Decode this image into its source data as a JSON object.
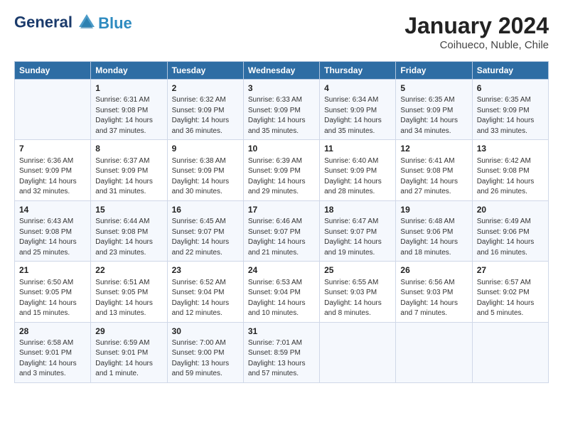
{
  "logo": {
    "line1": "General",
    "line2": "Blue"
  },
  "title": "January 2024",
  "subtitle": "Coihueco, Nuble, Chile",
  "headers": [
    "Sunday",
    "Monday",
    "Tuesday",
    "Wednesday",
    "Thursday",
    "Friday",
    "Saturday"
  ],
  "weeks": [
    [
      {
        "num": "",
        "content": ""
      },
      {
        "num": "1",
        "content": "Sunrise: 6:31 AM\nSunset: 9:08 PM\nDaylight: 14 hours\nand 37 minutes."
      },
      {
        "num": "2",
        "content": "Sunrise: 6:32 AM\nSunset: 9:09 PM\nDaylight: 14 hours\nand 36 minutes."
      },
      {
        "num": "3",
        "content": "Sunrise: 6:33 AM\nSunset: 9:09 PM\nDaylight: 14 hours\nand 35 minutes."
      },
      {
        "num": "4",
        "content": "Sunrise: 6:34 AM\nSunset: 9:09 PM\nDaylight: 14 hours\nand 35 minutes."
      },
      {
        "num": "5",
        "content": "Sunrise: 6:35 AM\nSunset: 9:09 PM\nDaylight: 14 hours\nand 34 minutes."
      },
      {
        "num": "6",
        "content": "Sunrise: 6:35 AM\nSunset: 9:09 PM\nDaylight: 14 hours\nand 33 minutes."
      }
    ],
    [
      {
        "num": "7",
        "content": "Sunrise: 6:36 AM\nSunset: 9:09 PM\nDaylight: 14 hours\nand 32 minutes."
      },
      {
        "num": "8",
        "content": "Sunrise: 6:37 AM\nSunset: 9:09 PM\nDaylight: 14 hours\nand 31 minutes."
      },
      {
        "num": "9",
        "content": "Sunrise: 6:38 AM\nSunset: 9:09 PM\nDaylight: 14 hours\nand 30 minutes."
      },
      {
        "num": "10",
        "content": "Sunrise: 6:39 AM\nSunset: 9:09 PM\nDaylight: 14 hours\nand 29 minutes."
      },
      {
        "num": "11",
        "content": "Sunrise: 6:40 AM\nSunset: 9:09 PM\nDaylight: 14 hours\nand 28 minutes."
      },
      {
        "num": "12",
        "content": "Sunrise: 6:41 AM\nSunset: 9:08 PM\nDaylight: 14 hours\nand 27 minutes."
      },
      {
        "num": "13",
        "content": "Sunrise: 6:42 AM\nSunset: 9:08 PM\nDaylight: 14 hours\nand 26 minutes."
      }
    ],
    [
      {
        "num": "14",
        "content": "Sunrise: 6:43 AM\nSunset: 9:08 PM\nDaylight: 14 hours\nand 25 minutes."
      },
      {
        "num": "15",
        "content": "Sunrise: 6:44 AM\nSunset: 9:08 PM\nDaylight: 14 hours\nand 23 minutes."
      },
      {
        "num": "16",
        "content": "Sunrise: 6:45 AM\nSunset: 9:07 PM\nDaylight: 14 hours\nand 22 minutes."
      },
      {
        "num": "17",
        "content": "Sunrise: 6:46 AM\nSunset: 9:07 PM\nDaylight: 14 hours\nand 21 minutes."
      },
      {
        "num": "18",
        "content": "Sunrise: 6:47 AM\nSunset: 9:07 PM\nDaylight: 14 hours\nand 19 minutes."
      },
      {
        "num": "19",
        "content": "Sunrise: 6:48 AM\nSunset: 9:06 PM\nDaylight: 14 hours\nand 18 minutes."
      },
      {
        "num": "20",
        "content": "Sunrise: 6:49 AM\nSunset: 9:06 PM\nDaylight: 14 hours\nand 16 minutes."
      }
    ],
    [
      {
        "num": "21",
        "content": "Sunrise: 6:50 AM\nSunset: 9:05 PM\nDaylight: 14 hours\nand 15 minutes."
      },
      {
        "num": "22",
        "content": "Sunrise: 6:51 AM\nSunset: 9:05 PM\nDaylight: 14 hours\nand 13 minutes."
      },
      {
        "num": "23",
        "content": "Sunrise: 6:52 AM\nSunset: 9:04 PM\nDaylight: 14 hours\nand 12 minutes."
      },
      {
        "num": "24",
        "content": "Sunrise: 6:53 AM\nSunset: 9:04 PM\nDaylight: 14 hours\nand 10 minutes."
      },
      {
        "num": "25",
        "content": "Sunrise: 6:55 AM\nSunset: 9:03 PM\nDaylight: 14 hours\nand 8 minutes."
      },
      {
        "num": "26",
        "content": "Sunrise: 6:56 AM\nSunset: 9:03 PM\nDaylight: 14 hours\nand 7 minutes."
      },
      {
        "num": "27",
        "content": "Sunrise: 6:57 AM\nSunset: 9:02 PM\nDaylight: 14 hours\nand 5 minutes."
      }
    ],
    [
      {
        "num": "28",
        "content": "Sunrise: 6:58 AM\nSunset: 9:01 PM\nDaylight: 14 hours\nand 3 minutes."
      },
      {
        "num": "29",
        "content": "Sunrise: 6:59 AM\nSunset: 9:01 PM\nDaylight: 14 hours\nand 1 minute."
      },
      {
        "num": "30",
        "content": "Sunrise: 7:00 AM\nSunset: 9:00 PM\nDaylight: 13 hours\nand 59 minutes."
      },
      {
        "num": "31",
        "content": "Sunrise: 7:01 AM\nSunset: 8:59 PM\nDaylight: 13 hours\nand 57 minutes."
      },
      {
        "num": "",
        "content": ""
      },
      {
        "num": "",
        "content": ""
      },
      {
        "num": "",
        "content": ""
      }
    ]
  ]
}
